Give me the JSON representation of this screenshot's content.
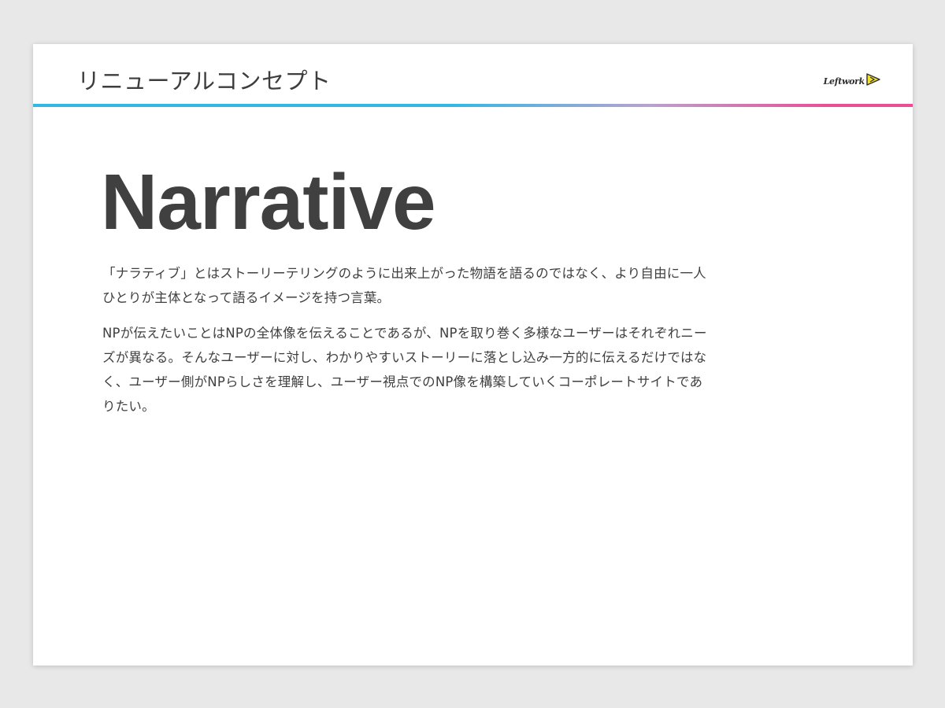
{
  "slide": {
    "title": "リニューアルコンセプト",
    "logo": {
      "text": "Leftwork",
      "mark": "triangle-play-icon",
      "colors": {
        "mark_fill": "#f2e033",
        "mark_stroke": "#2d2d2d"
      }
    },
    "header_rule_colors": {
      "start": "#33b8e6",
      "middle": "#b9a2cd",
      "end": "#ea4f96"
    }
  },
  "content": {
    "heading": "Narrative",
    "paragraphs": [
      "「ナラティブ」とはストーリーテリングのように出来上がった物語を語るのではなく、より自由に一人ひとりが主体となって語るイメージを持つ言葉。",
      "NPが伝えたいことはNPの全体像を伝えることであるが、NPを取り巻く多様なユーザーはそれぞれニーズが異なる。そんなユーザーに対し、わかりやすいストーリーに落とし込み一方的に伝えるだけではなく、ユーザー側がNPらしさを理解し、ユーザー視点でのNP像を構築していくコーポレートサイトでありたい。"
    ]
  }
}
